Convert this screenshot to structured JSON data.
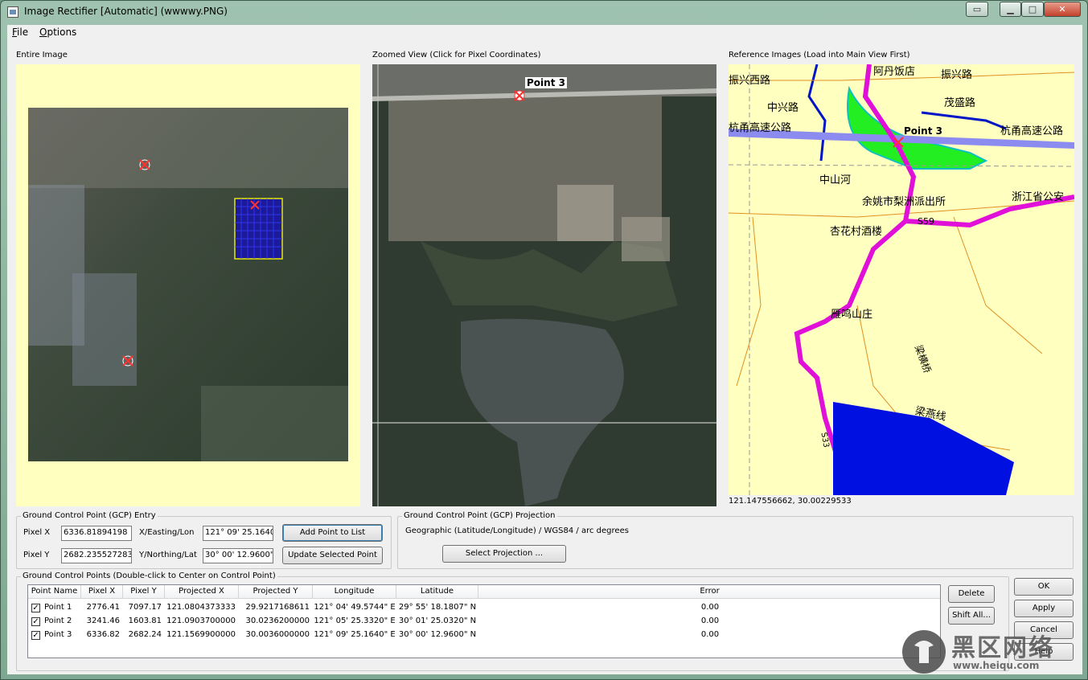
{
  "window": {
    "title": "Image Rectifier [Automatic] (wwwwy.PNG)"
  },
  "menu": {
    "file": "File",
    "options": "Options"
  },
  "panes": {
    "entire_label": "Entire Image",
    "zoomed_label": "Zoomed View (Click for Pixel Coordinates)",
    "reference_label": "Reference Images (Load into Main View First)",
    "zoom_point_label": "Point 3",
    "ref_point_label": "Point 3",
    "ref_coords": "121.147556662, 30.00229533"
  },
  "map_labels": {
    "road1": "振兴西路",
    "place1": "阿丹饭店",
    "road2": "振兴路",
    "road3": "中兴路",
    "road4": "茂盛路",
    "highway": "杭甬高速公路",
    "highway2": "杭甬高速公路",
    "river": "中山河",
    "police": "余姚市梨洲派出所",
    "province": "浙江省公安",
    "s59": "S59",
    "restaurant": "杏花村酒楼",
    "villa": "雁鸣山庄",
    "bridge": "梁横桥",
    "line": "梁燕线",
    "s33": "S33",
    "colors": {
      "background": "#ffffc0",
      "road": "#e010d8",
      "highway": "#8c8cf0",
      "water": "#0010e0",
      "park": "#22ee22",
      "minor_road": "#e09020"
    }
  },
  "gcp_entry": {
    "title": "Ground Control Point (GCP) Entry",
    "pixel_x_label": "Pixel X",
    "pixel_x": "6336.81894198",
    "pixel_y_label": "Pixel Y",
    "pixel_y": "2682.2355272835",
    "easting_label": "X/Easting/Lon",
    "easting": "121° 09' 25.1640\"",
    "northing_label": "Y/Northing/Lat",
    "northing": "30° 00' 12.9600\"",
    "add_button": "Add Point to List",
    "update_button": "Update Selected Point"
  },
  "gcp_projection": {
    "title": "Ground Control Point (GCP) Projection",
    "text": "Geographic (Latitude/Longitude) / WGS84 / arc degrees",
    "select_button": "Select Projection ..."
  },
  "gcp_list": {
    "title": "Ground Control Points (Double-click to Center on Control Point)",
    "columns": [
      "Point Name",
      "Pixel X",
      "Pixel Y",
      "Projected X",
      "Projected Y",
      "Longitude",
      "Latitude",
      "Error"
    ],
    "rows": [
      {
        "checked": true,
        "name": "Point 1",
        "px": "2776.41",
        "py": "7097.17",
        "projx": "121.0804373333",
        "projy": "29.9217168611",
        "lon": "121° 04' 49.5744\" E",
        "lat": "29° 55' 18.1807\" N",
        "err": "0.00"
      },
      {
        "checked": true,
        "name": "Point 2",
        "px": "3241.46",
        "py": "1603.81",
        "projx": "121.0903700000",
        "projy": "30.0236200000",
        "lon": "121° 05' 25.3320\" E",
        "lat": "30° 01' 25.0320\" N",
        "err": "0.00"
      },
      {
        "checked": true,
        "name": "Point 3",
        "px": "6336.82",
        "py": "2682.24",
        "projx": "121.1569900000",
        "projy": "30.0036000000",
        "lon": "121° 09' 25.1640\" E",
        "lat": "30° 00' 12.9600\" N",
        "err": "0.00"
      }
    ],
    "delete_button": "Delete",
    "shift_button": "Shift All..."
  },
  "dialog_buttons": {
    "ok": "OK",
    "apply": "Apply",
    "cancel": "Cancel",
    "help": "Help"
  },
  "watermark": {
    "brand": "黑区网络",
    "url": "www.heiqu.com"
  }
}
